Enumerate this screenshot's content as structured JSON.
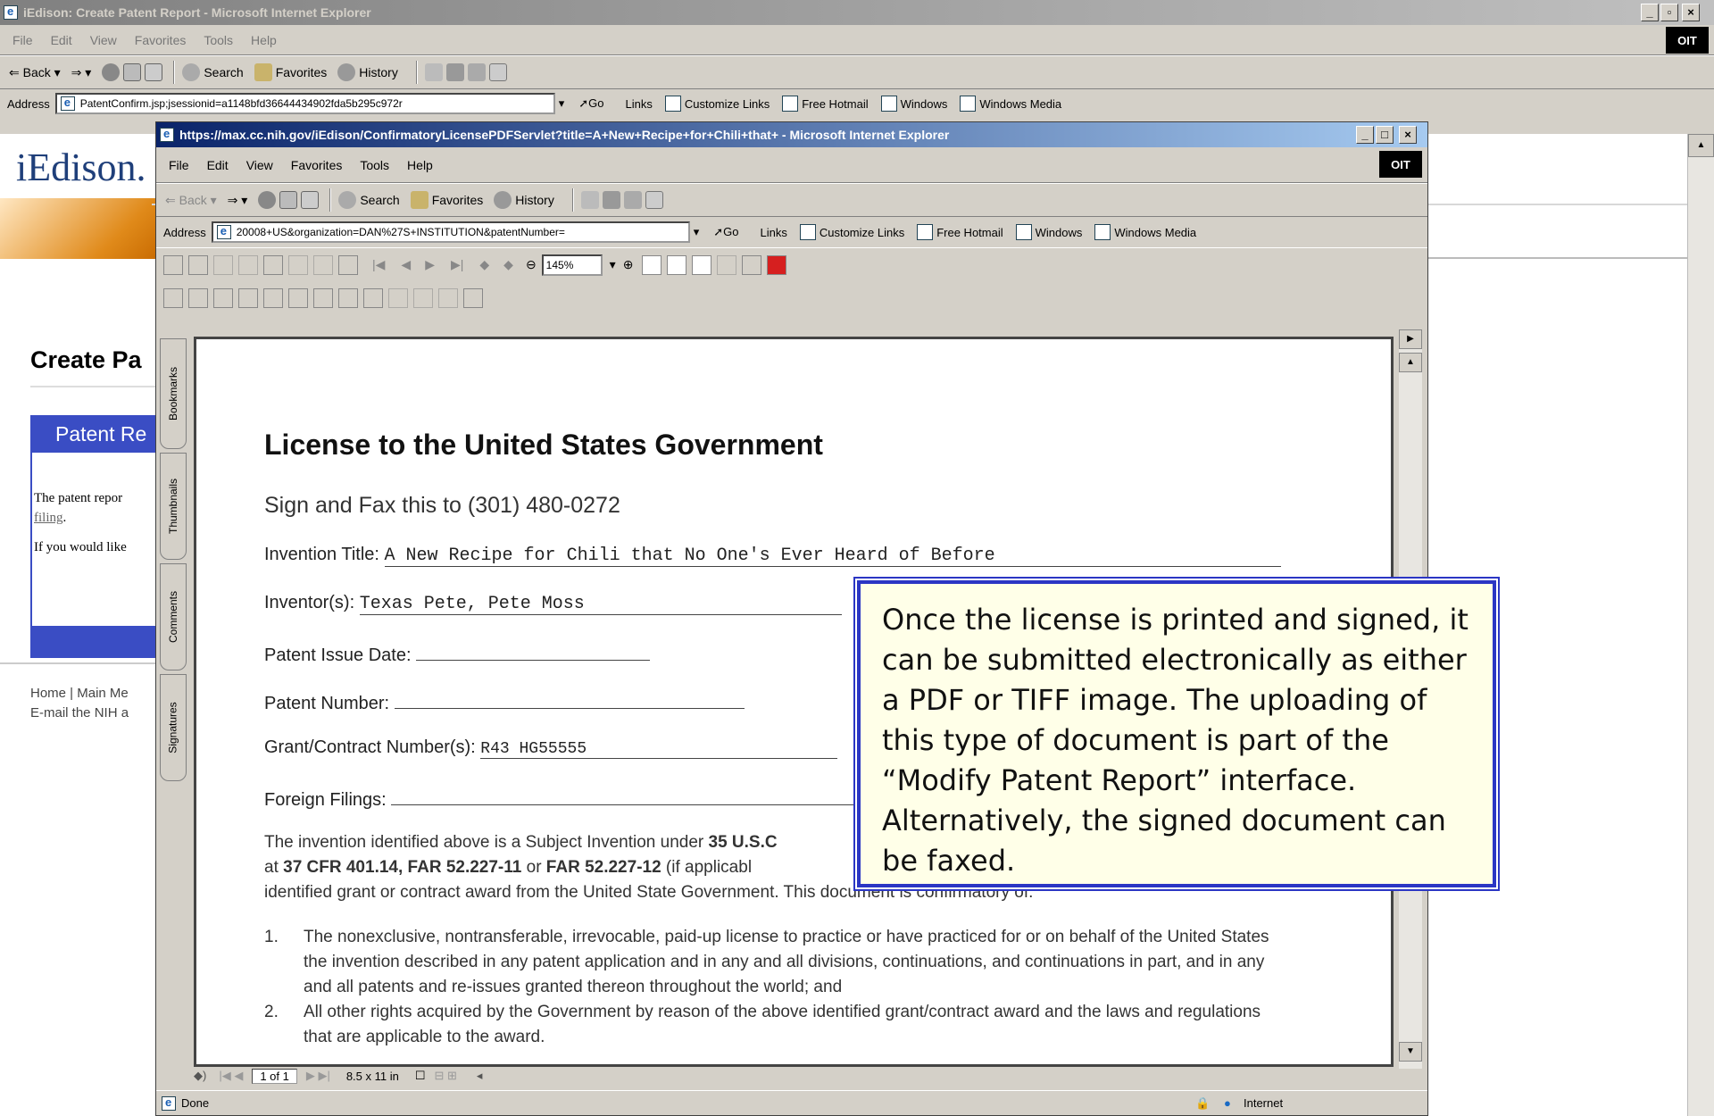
{
  "outer": {
    "title": "iEdison: Create Patent Report - Microsoft Internet Explorer",
    "menu": [
      "File",
      "Edit",
      "View",
      "Favorites",
      "Tools",
      "Help"
    ],
    "toolbar": {
      "back": "Back",
      "search": "Search",
      "favorites": "Favorites",
      "history": "History"
    },
    "address_label": "Address",
    "address": "PatentConfirm.jsp;jsessionid=a1148bfd36644434902fda5b295c972r",
    "go": "Go",
    "links_label": "Links",
    "links": [
      "Customize Links",
      "Free Hotmail",
      "Windows",
      "Windows Media"
    ],
    "logo_badge": "OIT"
  },
  "page": {
    "logo": "iEdison.",
    "heading": "Create Pa",
    "panel_title": "Patent Re",
    "text1": "The patent repor",
    "text1_link": "filing",
    "text2": "If you would like",
    "footer1": "Home | Main Me",
    "footer2": "E-mail the NIH a"
  },
  "inner": {
    "title": "https://max.cc.nih.gov/iEdison/ConfirmatoryLicensePDFServlet?title=A+New+Recipe+for+Chili+that+ - Microsoft Internet Explorer",
    "menu": [
      "File",
      "Edit",
      "View",
      "Favorites",
      "Tools",
      "Help"
    ],
    "toolbar": {
      "back": "Back",
      "search": "Search",
      "favorites": "Favorites",
      "history": "History"
    },
    "address_label": "Address",
    "address": "20008+US&organization=DAN%27S+INSTITUTION&patentNumber=",
    "go": "Go",
    "links_label": "Links",
    "links": [
      "Customize Links",
      "Free Hotmail",
      "Windows",
      "Windows Media"
    ],
    "logo_badge": "OIT",
    "zoom": "145%",
    "tabs": [
      "Bookmarks",
      "Thumbnails",
      "Comments",
      "Signatures"
    ],
    "page_indicator": "1 of 1",
    "page_size": "8.5 x 11 in",
    "status_left": "Done",
    "status_zone": "Internet"
  },
  "doc": {
    "title": "License to the United States Government",
    "fax": "Sign and Fax this to (301) 480-0272",
    "invention_label": "Invention Title:",
    "invention_value": "A New Recipe for Chili that No One's Ever Heard of Before",
    "inventor_label": "Inventor(s):",
    "inventor_value": "Texas Pete, Pete Moss",
    "issue_label": "Patent Issue Date:",
    "number_label": "Patent Number:",
    "grant_label": "Grant/Contract Number(s):",
    "grant_value": "R43 HG55555",
    "foreign_label": "Foreign Filings:",
    "para_a": "The invention identified above is a Subject Invention under ",
    "para_b": "35 U.S.C",
    "para_c": "at ",
    "para_d": "37 CFR 401.14, FAR 52.227-11",
    "para_e": " or ",
    "para_f": "FAR 52.227-12",
    "para_g": " (if applicabl",
    "para_h": "identified grant or contract award from the United State Government.  This document is confirmatory of:",
    "item1_num": "1.",
    "item1": "The nonexclusive, nontransferable, irrevocable, paid-up license to practice or have practiced for or on behalf of the United States the invention described in any patent application and in any and all divisions, continuations, and continuations in part, and in any and all patents and re-issues granted thereon throughout the world; and",
    "item2_num": "2.",
    "item2": "All other rights acquired by the Government by reason of the above identified grant/contract award and the laws and regulations that are applicable to the award."
  },
  "callout": {
    "text": "Once the license is printed and signed, it can be submitted electronically as either a PDF or TIFF image.  The uploading of this type of document is part of the “Modify Patent Report” interface.  Alternatively, the signed document can be faxed."
  }
}
